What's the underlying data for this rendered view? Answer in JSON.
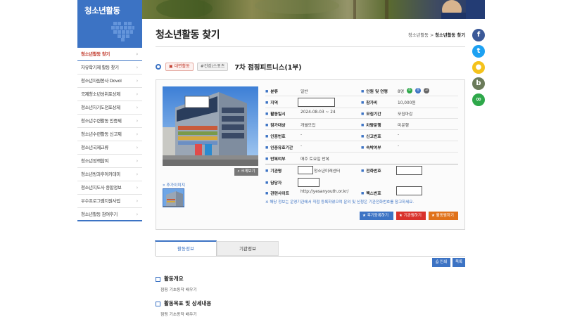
{
  "sidebar": {
    "heading": "청소년활동",
    "items": [
      {
        "label": "청소년활동 찾기",
        "active": true
      },
      {
        "label": "자유학기제 활동 찾기"
      },
      {
        "label": "청소년자원봉사 Dovol"
      },
      {
        "label": "국제청소년성취포상제"
      },
      {
        "label": "청소년자기도전포상제"
      },
      {
        "label": "청소년수련활동 인증제"
      },
      {
        "label": "청소년수련활동 신고제"
      },
      {
        "label": "청소년국제교류"
      },
      {
        "label": "청소년정책참여"
      },
      {
        "label": "청소년방과후아카데미"
      },
      {
        "label": "청소년지도사 종합정보"
      },
      {
        "label": "우수프로그램지원사업"
      },
      {
        "label": "청소년활동 참여후기"
      }
    ]
  },
  "header": {
    "title": "청소년활동 찾기",
    "breadcrumb_parent": "청소년활동",
    "breadcrumb_sep": ">",
    "breadcrumb_current": "청소년활동 찾기"
  },
  "social": [
    {
      "name": "facebook-icon",
      "glyph": "f",
      "color": "#3b5998"
    },
    {
      "name": "twitter-icon",
      "glyph": "t",
      "color": "#1da1f2"
    },
    {
      "name": "kakaostory-icon",
      "glyph": "●",
      "color": "#f4c21b"
    },
    {
      "name": "band-icon",
      "glyph": "b",
      "color": "#6b7b5a"
    },
    {
      "name": "link-icon",
      "glyph": "∞",
      "color": "#2ea84a"
    }
  ],
  "activity": {
    "tag1": "대면활동",
    "tag2": "건강/스포츠",
    "title": "7차 점핑피트니스(1부)",
    "zoom_label": "크게보기",
    "more_images": "추가이미지"
  },
  "fields": {
    "category_label": "분류",
    "category_value": "일반",
    "headcount_label": "인원 및 연령",
    "headcount_value": "8명",
    "region_label": "지역",
    "fee_label": "참가비",
    "fee_value": "10,000원",
    "period_label": "활동일시",
    "period_value": "2024-08-03 ~ 24",
    "recruit_label": "모집기간",
    "recruit_value": "모집마감",
    "target_label": "참가대상",
    "target_value": "개별모집",
    "vehicle_label": "차량운행",
    "vehicle_value": "미운행",
    "cert_no_label": "인증번호",
    "cert_no_value": "-",
    "report_no_label": "신고번호",
    "report_no_value": "-",
    "cert_valid_label": "인증유효기간",
    "cert_valid_value": "-",
    "lodging_label": "숙박여부",
    "lodging_value": "-",
    "repeat_label": "반복여부",
    "repeat_value": "매주 토요일 반복",
    "org_label": "기관명",
    "org_value": "청소년미래센터",
    "phone_label": "전화번호",
    "manager_label": "담당자",
    "site_label": "관련사이트",
    "site_value": "http://yesanyouth.or.kr/",
    "fax_label": "팩스번호",
    "notice": "※ 해당 정보는 운영기관에서 직접 등록하였으며 문의 및 신청은 기관전화번호를 참고하세요."
  },
  "buttons": {
    "review": "후기등록하기",
    "favorite_org": "기관찜하기",
    "favorite_act": "활동찜하기",
    "print": "인쇄",
    "list": "목록"
  },
  "tabs": [
    "활동정보",
    "기관정보"
  ],
  "sections": [
    {
      "heading": "활동개요",
      "text": "점핑 기초동작 배우기"
    },
    {
      "heading": "활동목표 및 상세내용",
      "text": "점핑 기초동작 배우기"
    }
  ]
}
